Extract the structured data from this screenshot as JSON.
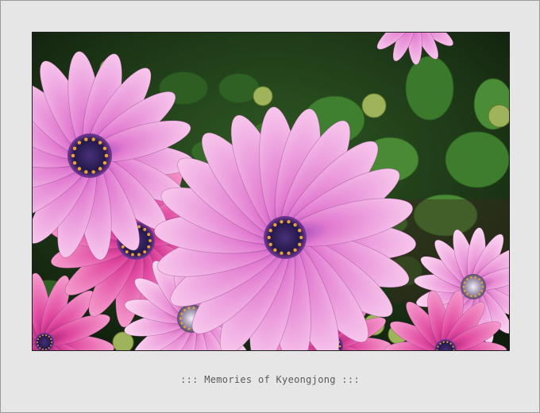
{
  "caption": "::: Memories of Kyeongjong :::",
  "photo": {
    "subject": "pink daisy flowers",
    "colors": {
      "mat": "#e6e6e6",
      "foliage_dark": "#1d3217",
      "leaf": "#3f7a2e",
      "petal_pink": "#e36ec4",
      "petal_light": "#f3b9e6",
      "petal_magenta": "#d93ea0",
      "center": "#2e1d55"
    }
  }
}
